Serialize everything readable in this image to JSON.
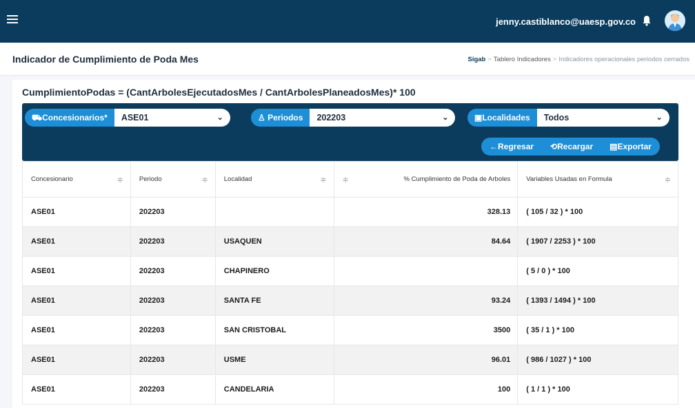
{
  "header": {
    "user_email": "jenny.castiblanco@uaesp.gov.co"
  },
  "page": {
    "title": "Indicador de Cumplimiento de Poda Mes",
    "breadcrumb": [
      "Sigab",
      "Tablero Indicadores",
      "Indicadores operacionales periodos cerrados"
    ]
  },
  "formula": "CumplimientoPodas = (CantArbolesEjecutadosMes / CantArbolesPlaneadosMes)* 100",
  "filters": {
    "concesionarios": {
      "label": "Concesionarios*",
      "value": "ASE01"
    },
    "periodos": {
      "label": "Periodos",
      "value": "202203"
    },
    "localidades": {
      "label": "Localidades",
      "value": "Todos"
    }
  },
  "actions": {
    "regresar": "←Regresar",
    "recargar": "Recargar",
    "exportar": "Exportar"
  },
  "table": {
    "columns": [
      "Concesionario",
      "Periodo",
      "Localidad",
      "% Cumplimiento de Poda de Arboles",
      "Variables Usadas en Formula"
    ],
    "rows": [
      [
        "ASE01",
        "202203",
        "",
        "328.13",
        "( 105 / 32 ) * 100"
      ],
      [
        "ASE01",
        "202203",
        "USAQUEN",
        "84.64",
        "( 1907 / 2253 ) * 100"
      ],
      [
        "ASE01",
        "202203",
        "CHAPINERO",
        "",
        "( 5 / 0 ) * 100"
      ],
      [
        "ASE01",
        "202203",
        "SANTA FE",
        "93.24",
        "( 1393 / 1494 ) * 100"
      ],
      [
        "ASE01",
        "202203",
        "SAN CRISTOBAL",
        "3500",
        "( 35 / 1 ) * 100"
      ],
      [
        "ASE01",
        "202203",
        "USME",
        "96.01",
        "( 986 / 1027 ) * 100"
      ],
      [
        "ASE01",
        "202203",
        "CANDELARIA",
        "100",
        "( 1 / 1 ) * 100"
      ]
    ]
  },
  "colors": {
    "header_bg": "#0b3c5d",
    "accent": "#1e8fd6",
    "row_alt": "#f2f2f2"
  },
  "icons": [
    "menu-icon",
    "bell-icon",
    "avatar",
    "car-icon",
    "person-icon",
    "map-icon",
    "chevron-down-icon",
    "refresh-icon",
    "export-icon",
    "filter-icon"
  ]
}
